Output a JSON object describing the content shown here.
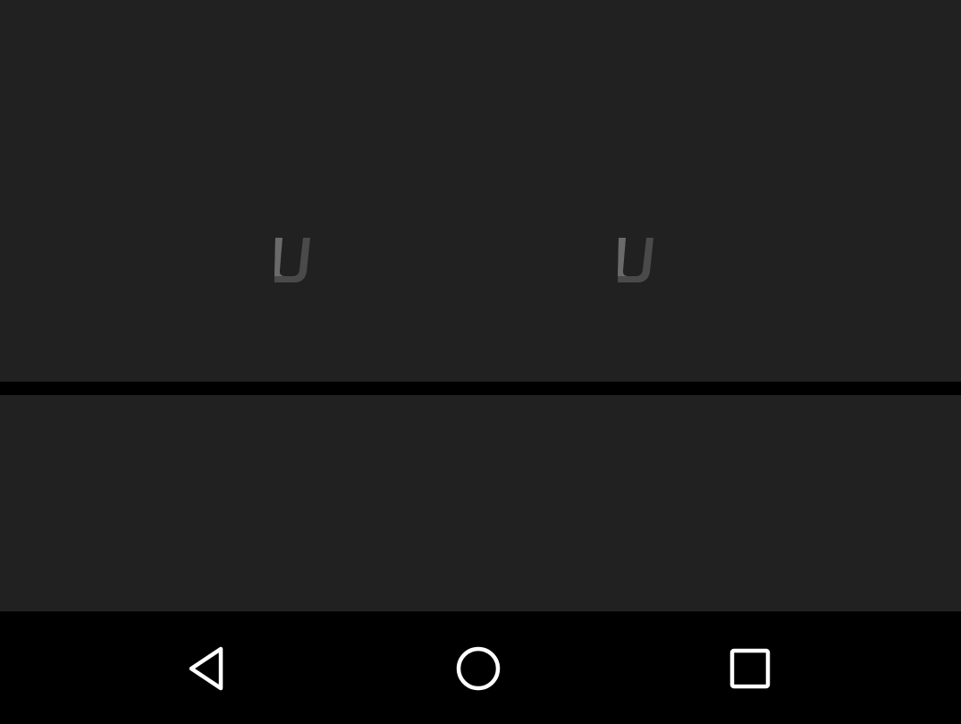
{
  "app_surfaces": {
    "top_pane_color": "#212121",
    "bottom_pane_color": "#212121",
    "divider_color": "#000000"
  },
  "partial_glyphs": [
    {
      "icon": "partial-logo-glyph",
      "color": "#5a5a5a"
    },
    {
      "icon": "partial-logo-glyph",
      "color": "#5a5a5a"
    }
  ],
  "navigation_bar": {
    "background": "#000000",
    "icon_color": "#ffffff",
    "buttons": [
      {
        "icon": "back-triangle-icon"
      },
      {
        "icon": "home-circle-icon"
      },
      {
        "icon": "recents-square-icon"
      }
    ]
  }
}
